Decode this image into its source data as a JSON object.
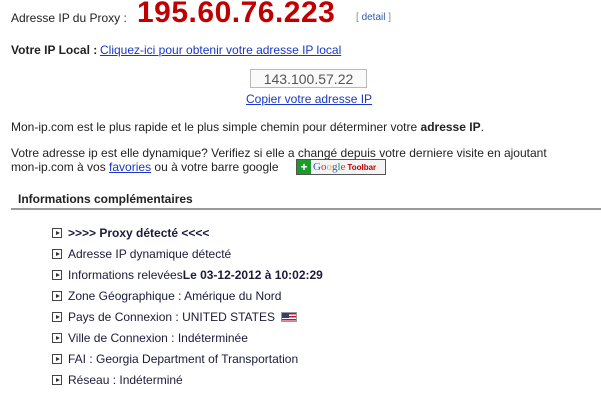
{
  "proxy": {
    "label": "Adresse IP du Proxy :",
    "ip": "195.60.76.223",
    "detail_open": "[",
    "detail_link": "detail",
    "detail_close": "]"
  },
  "local_ip": {
    "label": "Votre IP Local :",
    "link": "Cliquez-ici pour obtenir votre adresse IP local"
  },
  "ip_box": {
    "value": "143.100.57.22",
    "copy_link": "Copier votre adresse IP"
  },
  "description": {
    "text": "Mon-ip.com est le plus rapide et le plus simple chemin pour déterminer votre ",
    "bold": "adresse IP",
    "end": "."
  },
  "dynamic": {
    "line1": "Votre adresse ip est elle dynamique? Verifiez si elle a changé depuis votre derniere visite en ajoutant",
    "line2_start": "mon-ip.com à vos ",
    "favorites_link": "favories",
    "line2_end": " ou à votre barre google",
    "toolbar_button": {
      "plus": "+",
      "letters": [
        "G",
        "o",
        "o",
        "g",
        "l",
        "e"
      ],
      "suffix": "Toolbar"
    }
  },
  "section": {
    "title": "Informations complémentaires"
  },
  "info": {
    "proxy_detected": ">>>> Proxy détecté <<<<",
    "dynamic_ip": "Adresse IP dynamique détecté",
    "retrieved_label": "Informations relevées ",
    "retrieved_value": "Le 03-12-2012 à 10:02:29",
    "zone": "Zone Géographique : Amérique du Nord",
    "country": "Pays de Connexion : UNITED STATES",
    "country_flag": "us-flag-icon",
    "city": "Ville de Connexion : Indéterminée",
    "isp": "FAI : Georgia Department of Transportation",
    "network": "Réseau : Indéterminé"
  },
  "colors": {
    "proxy_ip": "#c00000",
    "link": "#1a37c6"
  }
}
